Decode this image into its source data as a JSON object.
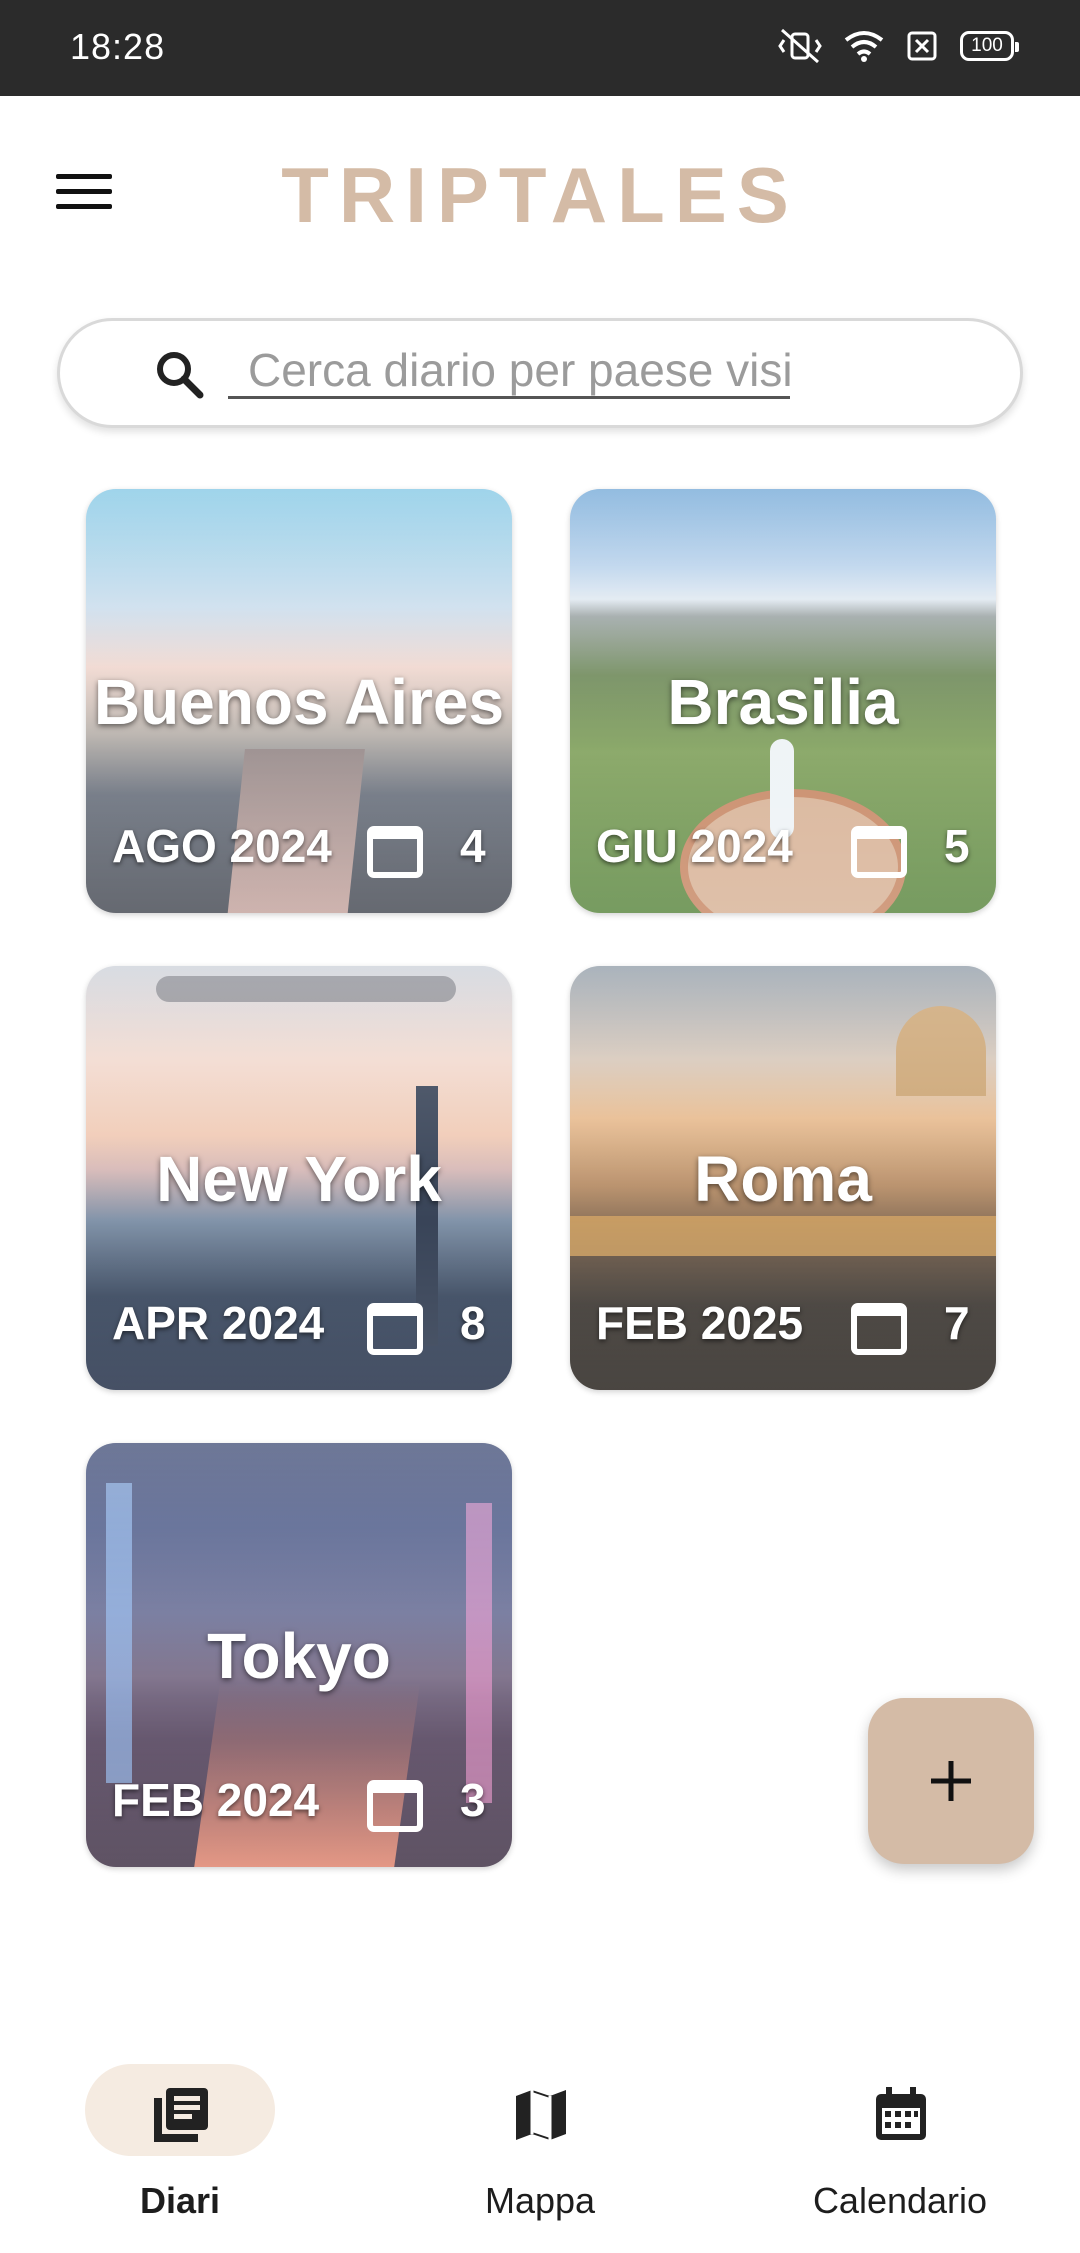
{
  "status_bar": {
    "time": "18:28",
    "battery": "100",
    "icons": [
      "vibrate-off-icon",
      "wifi-icon",
      "no-sim-icon",
      "battery-icon"
    ]
  },
  "header": {
    "title": "TRIPTALES",
    "menu_icon": "menu-icon",
    "title_color": "#d4bba6"
  },
  "search": {
    "placeholder": "Cerca diario per paese visit…",
    "value": "",
    "icon": "search-icon"
  },
  "diaries": [
    {
      "city": "Buenos Aires",
      "date": "AGO 2024",
      "days": "4"
    },
    {
      "city": "Brasilia",
      "date": "GIU 2024",
      "days": "5"
    },
    {
      "city": "New York",
      "date": "APR 2024",
      "days": "8"
    },
    {
      "city": "Roma",
      "date": "FEB 2025",
      "days": "7"
    },
    {
      "city": "Tokyo",
      "date": "FEB 2024",
      "days": "3"
    }
  ],
  "fab": {
    "icon": "plus-icon",
    "color": "#d4bba6"
  },
  "bottom_nav": {
    "items": [
      {
        "label": "Diari",
        "icon": "diary-icon",
        "active": true
      },
      {
        "label": "Mappa",
        "icon": "map-icon",
        "active": false
      },
      {
        "label": "Calendario",
        "icon": "calendar-icon",
        "active": false
      }
    ],
    "active_color": "#f5ebe1"
  }
}
